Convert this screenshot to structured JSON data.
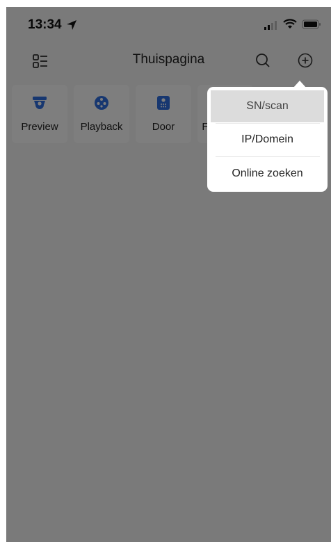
{
  "status_bar": {
    "time": "13:34"
  },
  "header": {
    "title": "Thuispagina"
  },
  "tiles": [
    {
      "label": "Preview",
      "icon": "camera-icon"
    },
    {
      "label": "Playback",
      "icon": "playback-reel-icon"
    },
    {
      "label": "Door",
      "icon": "door-intercom-icon"
    },
    {
      "label": "F",
      "icon": "tile-icon"
    }
  ],
  "dropdown": {
    "items": [
      {
        "label": "SN/scan",
        "active": true
      },
      {
        "label": "IP/Domein",
        "active": false
      },
      {
        "label": "Online zoeken",
        "active": false
      }
    ]
  },
  "colors": {
    "accent": "#2f6fe0",
    "overlay": "rgba(0,0,0,0.5)",
    "background": "#f4f4f4",
    "highlight": "#dcdcdc"
  }
}
